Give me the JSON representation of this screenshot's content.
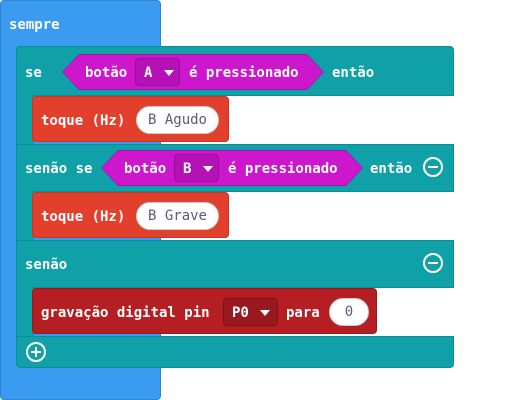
{
  "forever": {
    "label": "sempre"
  },
  "if_block": {
    "if_label": "se",
    "then_label": "então",
    "condition": {
      "prefix": "botão",
      "button": "A",
      "suffix": "é pressionado"
    }
  },
  "tone1": {
    "label": "toque (Hz)",
    "value": "B Agudo"
  },
  "elseif_block": {
    "label": "senão se",
    "then_label": "então",
    "condition": {
      "prefix": "botão",
      "button": "B",
      "suffix": "é pressionado"
    }
  },
  "tone2": {
    "label": "toque (Hz)",
    "value": "B Grave"
  },
  "else_block": {
    "label": "senão"
  },
  "digital_write": {
    "label": "gravação digital pin",
    "pin": "P0",
    "to_label": "para",
    "value": "0"
  },
  "colors": {
    "forever": "#3a9bf0",
    "logic": "#0fa0a8",
    "input": "#cc17cc",
    "music": "#e2402c",
    "pins": "#b51f23"
  },
  "icons": [
    "remove-branch-icon",
    "remove-branch-icon",
    "add-branch-icon",
    "dropdown-caret-icon"
  ]
}
